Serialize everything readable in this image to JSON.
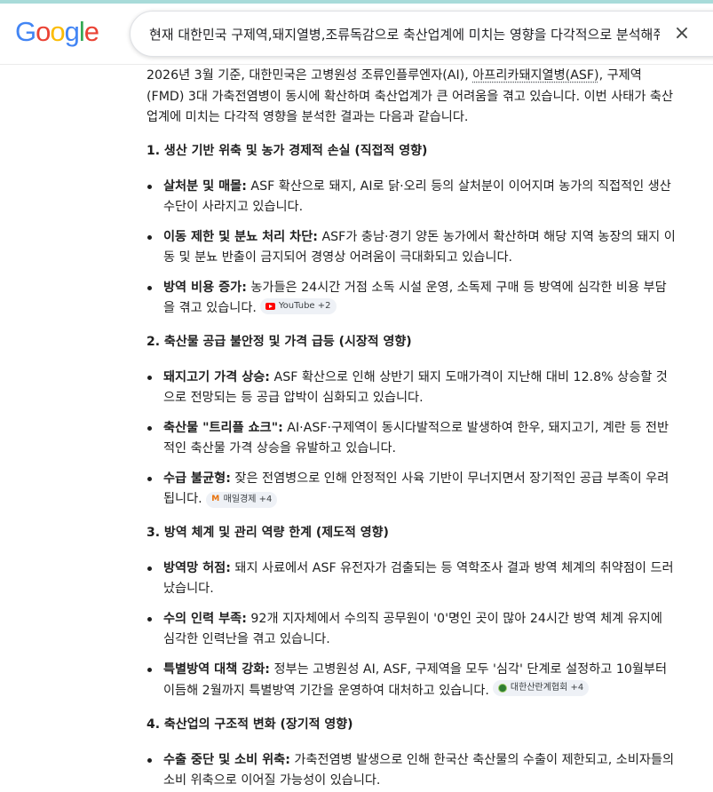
{
  "header": {
    "logo_letters": [
      {
        "char": "G",
        "color": "#4285F4"
      },
      {
        "char": "o",
        "color": "#EA4335"
      },
      {
        "char": "o",
        "color": "#FBBC05"
      },
      {
        "char": "g",
        "color": "#4285F4"
      },
      {
        "char": "l",
        "color": "#34A853"
      },
      {
        "char": "e",
        "color": "#EA4335"
      }
    ],
    "search_query": "현재 대한민국 구제역,돼지열병,조류독감으로 축산업계에 미치는 영향을 다각적으로 분석해줘",
    "clear_icon": "×"
  },
  "intro": {
    "p1": "2026년 3월 기준, 대한민국은 고병원성 조류인플루엔자(AI), ",
    "p2": "아프리카돼지열병(ASF)",
    "p3": ", 구제역(FMD) 3대 가축전염병이 동시에 확산하며 축산업계가 큰 어려움을 겪고 있습니다. 이번 사태가 축산업계에 미치는 다각적 영향을 분석한 결과는 다음과 같습니다."
  },
  "sections": [
    {
      "heading": "1. 생산 기반 위축 및 농가 경제적 손실 (직접적 영향)",
      "items": [
        {
          "bold": "살처분 및 매몰:",
          "text": " ASF 확산으로 돼지, AI로 닭·오리 등의 살처분이 이어지며 농가의 직접적인 생산 수단이 사라지고 있습니다."
        },
        {
          "bold": "이동 제한 및 분뇨 처리 차단:",
          "text": " ASF가 충남·경기 양돈 농가에서 확산하며 해당 지역 농장의 돼지 이동 및 분뇨 반출이 금지되어 경영상 어려움이 극대화되고 있습니다."
        },
        {
          "bold": "방역 비용 증가:",
          "text": " 농가들은 24시간 거점 소독 시설 운영, 소독제 구매 등 방역에 심각한 비용 부담을 겪고 있습니다.",
          "chip": "YouTube +2",
          "chip_icon": "youtube-icon"
        }
      ]
    },
    {
      "heading": "2. 축산물 공급 불안정 및 가격 급등 (시장적 영향)",
      "items": [
        {
          "bold": "돼지고기 가격 상승:",
          "text": " ASF 확산으로 인해 상반기 돼지 도매가격이 지난해 대비 12.8% 상승할 것으로 전망되는 등 공급 압박이 심화되고 있습니다."
        },
        {
          "bold": "축산물 \"트리플 쇼크\":",
          "text": " AI·ASF·구제역이 동시다발적으로 발생하여 한우, 돼지고기, 계란 등 전반적인 축산물 가격 상승을 유발하고 있습니다."
        },
        {
          "bold": "수급 불균형:",
          "text": " 잦은 전염병으로 인해 안정적인 사육 기반이 무너지면서 장기적인 공급 부족이 우려됩니다.",
          "chip": "매일경제 +4",
          "chip_icon": "news-icon"
        }
      ]
    },
    {
      "heading": "3. 방역 체계 및 관리 역량 한계 (제도적 영향)",
      "items": [
        {
          "bold": "방역망 허점:",
          "text": " 돼지 사료에서 ASF 유전자가 검출되는 등 역학조사 결과 방역 체계의 취약점이 드러났습니다."
        },
        {
          "bold": "수의 인력 부족:",
          "text": " 92개 지자체에서 수의직 공무원이 '0'명인 곳이 많아 24시간 방역 체계 유지에 심각한 인력난을 겪고 있습니다."
        },
        {
          "bold": "특별방역 대책 강화:",
          "text": " 정부는 고병원성 AI, ASF, 구제역을 모두 '심각' 단계로 설정하고 10월부터 이듬해 2월까지 특별방역 기간을 운영하여 대처하고 있습니다.",
          "chip": "대한산란계협회 +4",
          "chip_icon": "association-icon"
        }
      ]
    },
    {
      "heading": "4. 축산업의 구조적 변화 (장기적 영향)",
      "items": [
        {
          "bold": "수출 중단 및 소비 위축:",
          "text": " 가축전염병 발생으로 인해 한국산 축산물의 수출이 제한되고, 소비자들의 소비 위축으로 이어질 가능성이 있습니다."
        }
      ]
    }
  ]
}
